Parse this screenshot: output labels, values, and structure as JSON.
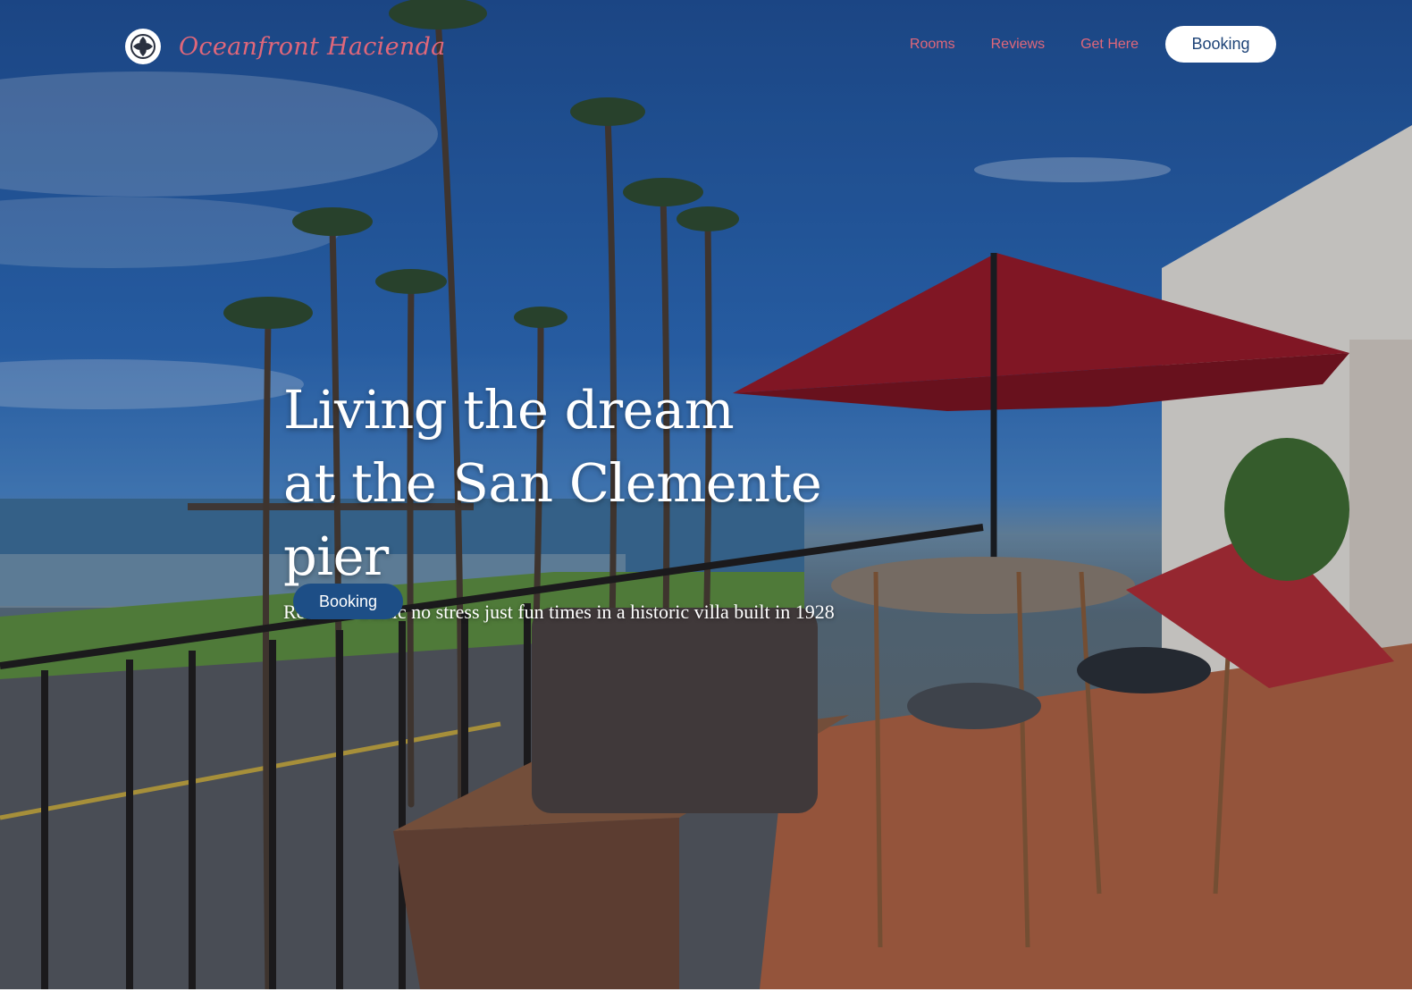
{
  "header": {
    "logo_text": "Oceanfront Hacienda",
    "logo_icon": "fleur-emblem-icon",
    "nav": [
      {
        "label": "Rooms"
      },
      {
        "label": "Reviews"
      },
      {
        "label": "Get Here"
      }
    ],
    "booking_label": "Booking"
  },
  "hero": {
    "headline_line1": "Living the dream",
    "headline_line2": "at the San Clemente pier",
    "subline": "Relax no traffic no stress just fun times in a historic villa built in 1928",
    "booking_label": "Booking",
    "image_alt": "balcony-with-red-umbrella-overlooking-pier-icon"
  },
  "colors": {
    "accent": "#e0677a",
    "button_primary": "#1d4e86",
    "button_text_dark": "#1d4377",
    "white": "#ffffff"
  }
}
